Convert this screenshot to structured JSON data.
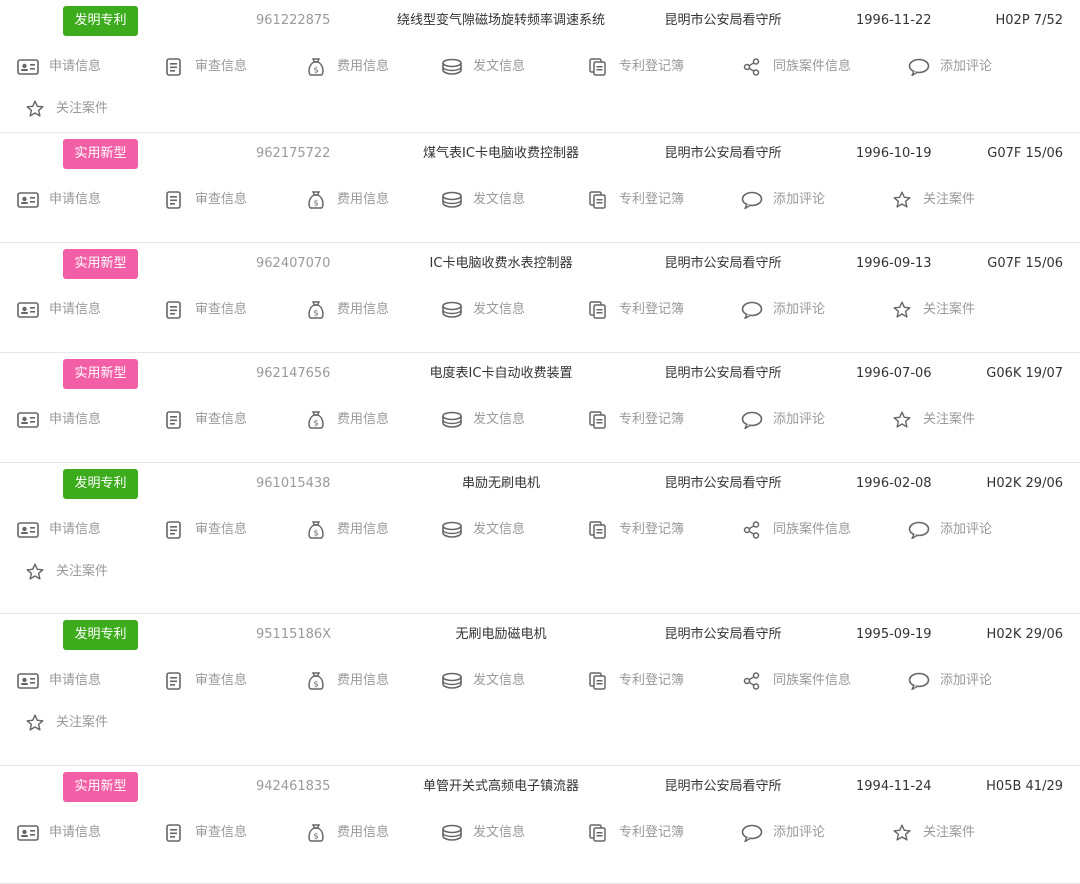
{
  "action_labels": {
    "apply": "申请信息",
    "review": "审查信息",
    "fee": "费用信息",
    "doc": "发文信息",
    "register": "专利登记簿",
    "family": "同族案件信息",
    "comment": "添加评论",
    "follow": "关注案件"
  },
  "icons": {
    "apply": "id-card-icon",
    "review": "document-icon",
    "fee": "money-bag-icon",
    "doc": "database-icon",
    "register": "register-book-icon",
    "family": "share-nodes-icon",
    "comment": "chat-bubble-icon",
    "follow": "star-outline-icon"
  },
  "colors": {
    "invention_badge": "#3cab1c",
    "utility_badge": "#f25fa6",
    "action_text": "#999999",
    "appno_text": "#9a9a9a"
  },
  "records": [
    {
      "type": "invention",
      "type_label": "发明专利",
      "app_no": "961222875",
      "title": "绕线型变气隙磁场旋转频率调速系统",
      "applicant": "昆明市公安局看守所",
      "date": "1996-11-22",
      "ipc": "H02P 7/52",
      "has_family": true
    },
    {
      "type": "utility",
      "type_label": "实用新型",
      "app_no": "962175722",
      "title": "煤气表IC卡电脑收费控制器",
      "applicant": "昆明市公安局看守所",
      "date": "1996-10-19",
      "ipc": "G07F 15/06",
      "has_family": false
    },
    {
      "type": "utility",
      "type_label": "实用新型",
      "app_no": "962407070",
      "title": "IC卡电脑收费水表控制器",
      "applicant": "昆明市公安局看守所",
      "date": "1996-09-13",
      "ipc": "G07F 15/06",
      "has_family": false
    },
    {
      "type": "utility",
      "type_label": "实用新型",
      "app_no": "962147656",
      "title": "电度表IC卡自动收费装置",
      "applicant": "昆明市公安局看守所",
      "date": "1996-07-06",
      "ipc": "G06K 19/07",
      "has_family": false
    },
    {
      "type": "invention",
      "type_label": "发明专利",
      "app_no": "961015438",
      "title": "串励无刷电机",
      "applicant": "昆明市公安局看守所",
      "date": "1996-02-08",
      "ipc": "H02K 29/06",
      "has_family": true
    },
    {
      "type": "invention",
      "type_label": "发明专利",
      "app_no": "95115186X",
      "title": "无刷电励磁电机",
      "applicant": "昆明市公安局看守所",
      "date": "1995-09-19",
      "ipc": "H02K 29/06",
      "has_family": true
    },
    {
      "type": "utility",
      "type_label": "实用新型",
      "app_no": "942461835",
      "title": "单管开关式高频电子镇流器",
      "applicant": "昆明市公安局看守所",
      "date": "1994-11-24",
      "ipc": "H05B 41/29",
      "has_family": false
    }
  ]
}
